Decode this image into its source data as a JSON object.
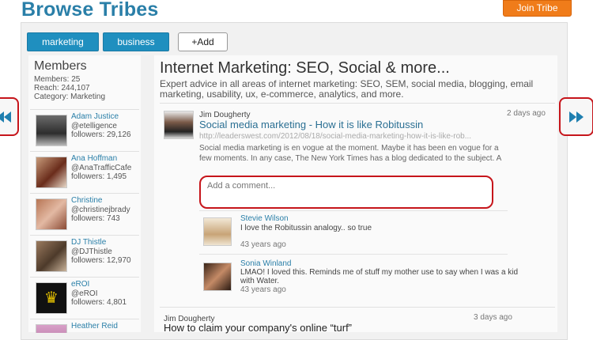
{
  "page": {
    "title": "Browse Tribes",
    "join_label": "Join Tribe"
  },
  "tags": [
    "marketing",
    "business"
  ],
  "add_label": "+Add",
  "members": {
    "heading": "Members",
    "members_line": "Members: 25",
    "reach_line": "Reach: 244,107",
    "category_line": "Category: Marketing",
    "list": [
      {
        "name": "Adam Justice",
        "handle": "@etelligence",
        "followers": "followers: 29,126"
      },
      {
        "name": "Ana Hoffman",
        "handle": "@AnaTrafficCafe",
        "followers": "followers: 1,495"
      },
      {
        "name": "Christine",
        "handle": "@christinejbrady",
        "followers": "followers: 743"
      },
      {
        "name": "DJ Thistle",
        "handle": "@DJThistle",
        "followers": "followers: 12,970"
      },
      {
        "name": "eROI",
        "handle": "@eROI",
        "followers": "followers: 4,801"
      },
      {
        "name": "Heather Reid",
        "handle": "",
        "followers": ""
      }
    ]
  },
  "tribe": {
    "title": "Internet Marketing: SEO, Social & more...",
    "description": "Expert advice in all areas of internet marketing: SEO, SEM, social media, blogging, email marketing, usability, ux, e-commerce, analytics, and more."
  },
  "posts": [
    {
      "author": "Jim Dougherty",
      "time": "2 days ago",
      "title": "Social media marketing - How it is like Robitussin",
      "url": "http://leaderswest.com/2012/08/18/social-media-marketing-how-it-is-like-rob...",
      "body": "Social media marketing is en vogue at the moment.  Maybe it has been en vogue for a few moments.  In any case, The New York Times has a blog dedicated to the subject. A",
      "comment_placeholder": "Add a comment...",
      "comments": [
        {
          "name": "Stevie Wilson",
          "text": "I love the Robitussin analogy.. so true",
          "time": "43 years ago"
        },
        {
          "name": "Sonia Winland",
          "text": "LMAO! I loved this. Reminds me of stuff my mother use to say when I was a kid with Water.",
          "time": "43 years ago"
        }
      ]
    },
    {
      "author": "Jim Dougherty",
      "time": "3 days ago",
      "title": "How to claim your company's online “turf”"
    }
  ],
  "colors": {
    "brand": "#2a7fa8",
    "accent": "#f07c1a",
    "highlight": "#c6151b",
    "tag": "#1f8fbf"
  },
  "icons": {
    "prev": "double-chevron-left-icon",
    "next": "double-chevron-right-icon"
  }
}
